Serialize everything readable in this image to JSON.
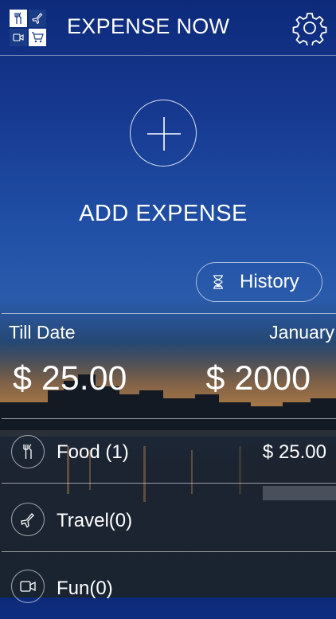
{
  "header": {
    "app_title": "EXPENSE NOW",
    "logo_icons": [
      "utensils-icon",
      "plane-icon",
      "video-icon",
      "cart-icon"
    ],
    "settings_icon": "gear-icon"
  },
  "add": {
    "icon": "plus-icon",
    "label": "ADD EXPENSE"
  },
  "history": {
    "icon": "hourglass-icon",
    "label": "History"
  },
  "summary": {
    "till_label": "Till Date",
    "till_amount": "$ 25.00",
    "month_label": "January",
    "month_amount": "$ 2000"
  },
  "categories": [
    {
      "icon": "utensils-icon",
      "label": "Food (1)",
      "amount": "$ 25.00"
    },
    {
      "icon": "plane-icon",
      "label": "Travel(0)",
      "amount": ""
    },
    {
      "icon": "video-icon",
      "label": "Fun(0)",
      "amount": ""
    }
  ],
  "colors": {
    "sky_top": "#0d2a7a",
    "sky_mid": "#2a5bab",
    "water": "#1a2330",
    "text": "#ffffff"
  }
}
